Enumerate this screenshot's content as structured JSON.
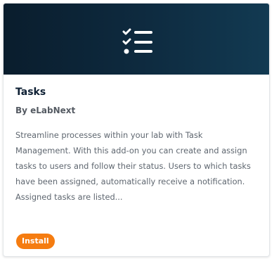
{
  "card": {
    "title": "Tasks",
    "author": "By eLabNext",
    "description": "Streamline processes within your lab with Task Management. With this add-on you can create and assign tasks to users and follow their status. Users to which tasks have been assigned, automatically receive a notification. Assigned tasks are listed...",
    "install_label": "Install",
    "icon": "task-list-icon"
  },
  "colors": {
    "banner": "#0e2b40",
    "accent": "#f57c10",
    "title": "#0d1f33"
  }
}
